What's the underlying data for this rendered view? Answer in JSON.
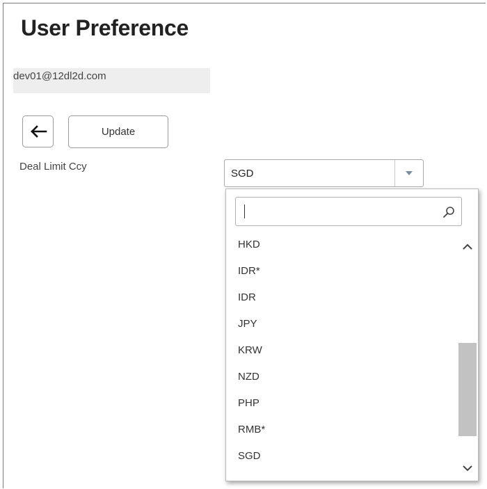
{
  "page": {
    "title": "User Preference",
    "user_email": "dev01@12dl2d.com"
  },
  "toolbar": {
    "back_icon": "arrow-left-icon",
    "update_label": "Update"
  },
  "form": {
    "deal_limit_label": "Deal Limit Ccy",
    "deal_limit_value": "SGD"
  },
  "dropdown": {
    "search_value": "",
    "search_icon": "search-icon",
    "options": [
      "HKD",
      "IDR*",
      "IDR",
      "JPY",
      "KRW",
      "NZD",
      "PHP",
      "RMB*",
      "SGD"
    ],
    "scroll_position": 0.55
  }
}
